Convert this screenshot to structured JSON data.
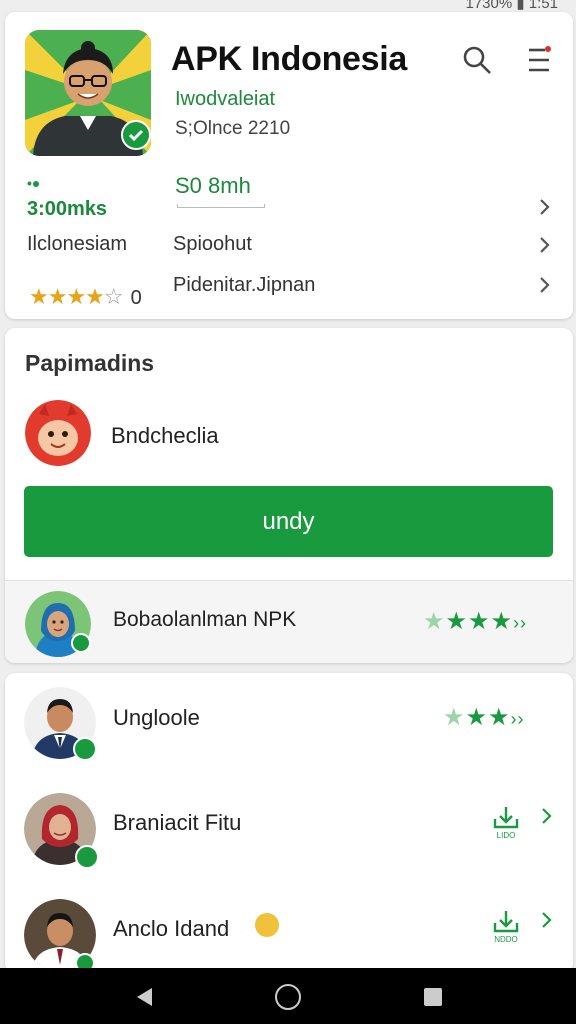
{
  "status": {
    "text": "1730% ▮ 1:51"
  },
  "app": {
    "title": "APK Indonesia",
    "developer": "Iwodvaleiat",
    "since": "S;Olnce 2210",
    "downloads_label": "•●",
    "downloads": "3:00mks",
    "size": "S0 8mh",
    "rows": [
      {
        "left": "Ilclonesiam",
        "right": "Spioohut"
      },
      {
        "stars": 4,
        "rating_text": "0",
        "right": "Pidenitar.Jipnan"
      }
    ]
  },
  "section": {
    "title": "Papimadins",
    "item_name": "Bndcheclia",
    "install_label": "undy",
    "featured_name": "Bobaolanlman NPK"
  },
  "list": {
    "items": [
      {
        "name": "Ungloole",
        "action": "stars"
      },
      {
        "name": "Braniacit Fitu",
        "action": "download",
        "dl_label": "LIDO"
      },
      {
        "name": "Anclo Idand",
        "action": "download",
        "dl_label": "NDDO"
      }
    ]
  },
  "colors": {
    "accent": "#1a9a3f",
    "star": "#e8a317"
  },
  "icons": [
    "search-icon",
    "menu-icon",
    "chevron-right-icon",
    "download-icon",
    "verified-badge-icon",
    "back-icon",
    "home-icon",
    "recents-icon"
  ]
}
